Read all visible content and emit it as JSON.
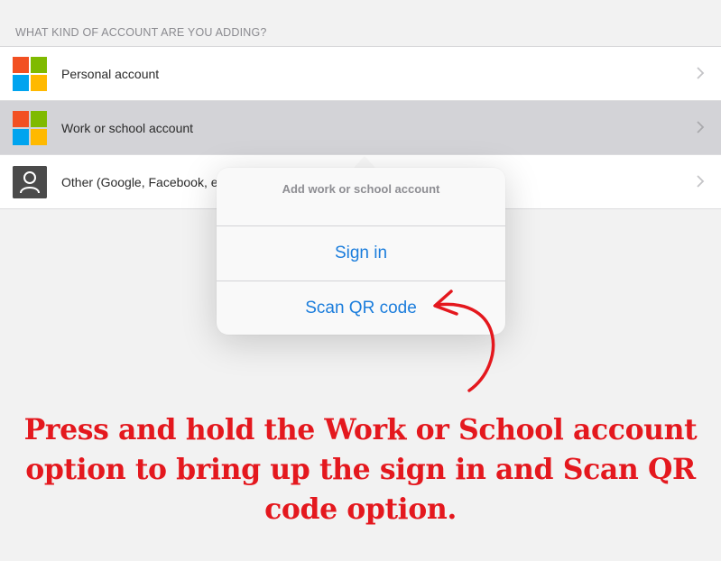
{
  "header": {
    "section_title": "WHAT KIND OF ACCOUNT ARE YOU ADDING?"
  },
  "accounts": [
    {
      "label": "Personal account",
      "icon": "microsoft-logo-icon"
    },
    {
      "label": "Work or school account",
      "icon": "microsoft-logo-icon",
      "selected": true
    },
    {
      "label": "Other (Google, Facebook, e",
      "icon": "person-icon"
    }
  ],
  "popover": {
    "title": "Add work or school account",
    "actions": [
      "Sign in",
      "Scan QR code"
    ]
  },
  "annotation": {
    "lines": [
      "Press and hold the Work or School account",
      "option to bring up the sign in and Scan QR",
      "code option."
    ]
  },
  "colors": {
    "ms_red": "#f25022",
    "ms_green": "#7fba00",
    "ms_blue": "#00a4ef",
    "ms_yellow": "#ffb900",
    "accent_blue": "#1b7ddc",
    "annotation_red": "#e4181e"
  }
}
